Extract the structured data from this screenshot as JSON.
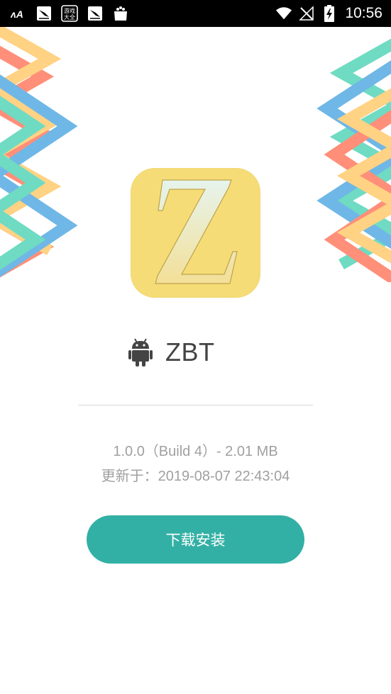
{
  "status_bar": {
    "time": "10:56",
    "left_icons": [
      "font-app-icon",
      "notification-app-icon",
      "games-center-icon",
      "notification-app-icon",
      "shopping-bag-icon"
    ],
    "games_center_label": "游戏大全",
    "right_icons": [
      "wifi-icon",
      "no-signal-icon",
      "battery-charging-icon"
    ]
  },
  "app": {
    "icon_letter": "Z",
    "name": "ZBT",
    "platform_icon": "android-icon",
    "version_line": "1.0.0（Build 4）- 2.01 MB",
    "updated_line": "更新于：2019-08-07 22:43:04"
  },
  "actions": {
    "install_label": "下载安装"
  },
  "colors": {
    "accent": "#33b0a5",
    "icon_bg": "#f6dc77",
    "stripe_orange": "#ff6a4d",
    "stripe_yellow": "#ffc45c",
    "stripe_blue": "#3fa0de",
    "stripe_teal": "#3fcfb0"
  }
}
